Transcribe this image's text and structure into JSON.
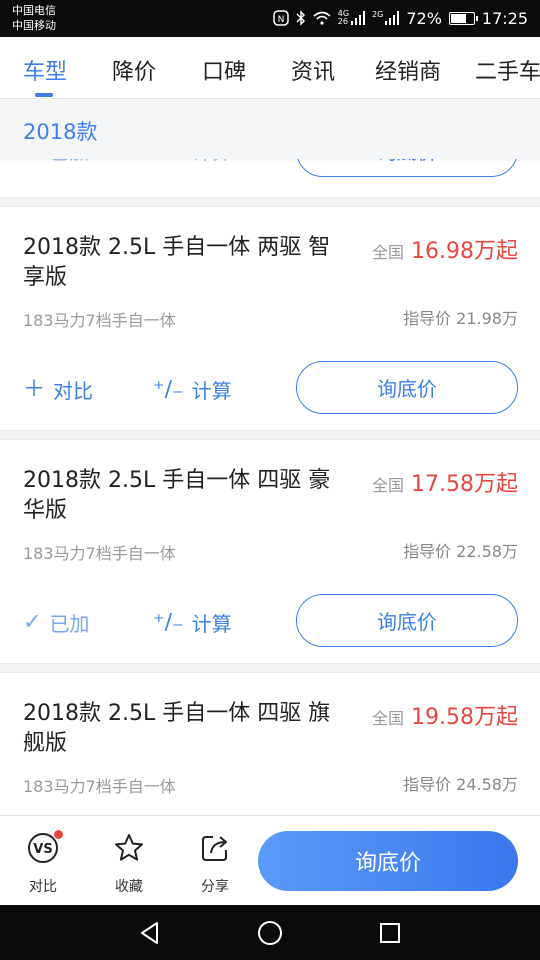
{
  "status_bar": {
    "carrier_1": "中国电信",
    "carrier_2": "中国移动",
    "network_1": "4G",
    "network_2": "26",
    "network_3": "2G",
    "battery": "72%",
    "battery_level": 0.72,
    "time": "17:25"
  },
  "tabs": [
    "车型",
    "降价",
    "口碑",
    "资讯",
    "经销商",
    "二手车"
  ],
  "active_tab": "车型",
  "section_header": "2018款",
  "partial_card": {
    "compare_label": "已加",
    "calc_label": "计算",
    "inquiry_label": "询底价"
  },
  "cars": [
    {
      "name": "2018款 2.5L 手自一体 两驱 智享版",
      "price_label": "全国",
      "price": "16.98万起",
      "spec": "183马力7档手自一体",
      "guide_price": "指导价 21.98万",
      "compare_label": "对比",
      "compare_icon": "plus-icon",
      "calc_label": "计算",
      "inquiry_label": "询底价"
    },
    {
      "name": "2018款 2.5L 手自一体 四驱 豪华版",
      "price_label": "全国",
      "price": "17.58万起",
      "spec": "183马力7档手自一体",
      "guide_price": "指导价 22.58万",
      "compare_label": "已加",
      "compare_icon": "check-icon",
      "calc_label": "计算",
      "inquiry_label": "询底价"
    },
    {
      "name": "2018款 2.5L 手自一体 四驱 旗舰版",
      "price_label": "全国",
      "price": "19.58万起",
      "spec": "183马力7档手自一体",
      "guide_price": "指导价 24.58万"
    }
  ],
  "bottom_bar": {
    "compare_label": "对比",
    "favorite_label": "收藏",
    "share_label": "分享",
    "inquiry_label": "询底价"
  },
  "colors": {
    "accent": "#3d7fe6",
    "price": "#e8473f"
  }
}
